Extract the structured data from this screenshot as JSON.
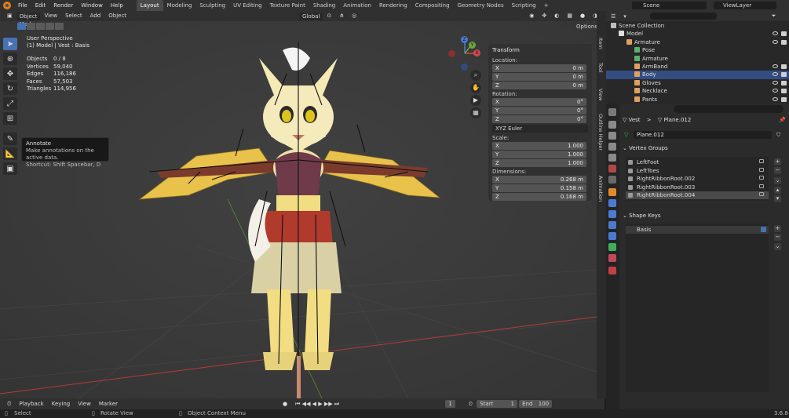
{
  "menu": [
    "File",
    "Edit",
    "Render",
    "Window",
    "Help"
  ],
  "workspaces": [
    {
      "label": "Layout",
      "active": true
    },
    {
      "label": "Modeling",
      "active": false
    },
    {
      "label": "Sculpting",
      "active": false
    },
    {
      "label": "UV Editing",
      "active": false
    },
    {
      "label": "Texture Paint",
      "active": false
    },
    {
      "label": "Shading",
      "active": false
    },
    {
      "label": "Animation",
      "active": false
    },
    {
      "label": "Rendering",
      "active": false
    },
    {
      "label": "Compositing",
      "active": false
    },
    {
      "label": "Geometry Nodes",
      "active": false
    },
    {
      "label": "Scripting",
      "active": false
    }
  ],
  "add_workspace": "+",
  "scene": "Scene",
  "view_layer": "ViewLayer",
  "viewport": {
    "mode": "Object Mode",
    "menus": [
      "View",
      "Select",
      "Add",
      "Object"
    ],
    "transform_orientation": "Global",
    "options": "Options",
    "perspective": "User Perspective",
    "context": "(1) Model | Vest : Basis",
    "stats": [
      {
        "k": "Objects",
        "v": "0 / 8"
      },
      {
        "k": "Vertices",
        "v": "59,040"
      },
      {
        "k": "Edges",
        "v": "116,186"
      },
      {
        "k": "Faces",
        "v": "57,503"
      },
      {
        "k": "Triangles",
        "v": "114,956"
      }
    ],
    "tooltip": {
      "title": "Annotate",
      "desc": "Make annotations on the active data.",
      "shortcut": "Shortcut: Shift Spacebar, D"
    },
    "gizmo": {
      "x": "X",
      "y": "Y",
      "z": "Z"
    }
  },
  "sidebar_tabs": [
    "Item",
    "Tool",
    "View",
    "Outline Helper",
    "Animation"
  ],
  "transform": {
    "title": "Transform",
    "location_label": "Location:",
    "location": [
      {
        "a": "X",
        "v": "0 m"
      },
      {
        "a": "Y",
        "v": "0 m"
      },
      {
        "a": "Z",
        "v": "0 m"
      }
    ],
    "rotation_label": "Rotation:",
    "rotation": [
      {
        "a": "X",
        "v": "0°"
      },
      {
        "a": "Y",
        "v": "0°"
      },
      {
        "a": "Z",
        "v": "0°"
      }
    ],
    "rotation_mode": "XYZ Euler",
    "scale_label": "Scale:",
    "scale": [
      {
        "a": "X",
        "v": "1.000"
      },
      {
        "a": "Y",
        "v": "1.000"
      },
      {
        "a": "Z",
        "v": "1.000"
      }
    ],
    "dimensions_label": "Dimensions:",
    "dimensions": [
      {
        "a": "X",
        "v": "0.268 m"
      },
      {
        "a": "Y",
        "v": "0.158 m"
      },
      {
        "a": "Z",
        "v": "0.168 m"
      }
    ]
  },
  "timeline": {
    "menus": [
      "Playback",
      "Keying",
      "View",
      "Marker"
    ],
    "current_frame": "1",
    "start_label": "Start",
    "start": "1",
    "end_label": "End",
    "end": "100"
  },
  "status": {
    "select": "Select",
    "rotate": "Rotate View",
    "context": "Object Context Menu",
    "version": "3.6.8"
  },
  "outliner": {
    "rows": [
      {
        "label": "Scene Collection",
        "indent": 0,
        "color": "#bdbdbd",
        "sel": false,
        "vis": false
      },
      {
        "label": "Model",
        "indent": 1,
        "color": "#e0e0e0",
        "sel": false,
        "vis": true
      },
      {
        "label": "Armature",
        "indent": 2,
        "color": "#e0a060",
        "sel": false,
        "vis": true
      },
      {
        "label": "Pose",
        "indent": 3,
        "color": "#59b36e",
        "sel": false,
        "vis": false
      },
      {
        "label": "Armature",
        "indent": 3,
        "color": "#59b36e",
        "sel": false,
        "vis": false
      },
      {
        "label": "ArmBand",
        "indent": 3,
        "color": "#e0a060",
        "sel": false,
        "vis": true
      },
      {
        "label": "Body",
        "indent": 3,
        "color": "#e0a060",
        "sel": true,
        "vis": true
      },
      {
        "label": "Gloves",
        "indent": 3,
        "color": "#e0a060",
        "sel": false,
        "vis": true
      },
      {
        "label": "Necklace",
        "indent": 3,
        "color": "#e0a060",
        "sel": false,
        "vis": true
      },
      {
        "label": "Pants",
        "indent": 3,
        "color": "#e0a060",
        "sel": false,
        "vis": true
      }
    ]
  },
  "properties": {
    "breadcrumb_object": "Vest",
    "breadcrumb_sep": ">",
    "breadcrumb_data": "Plane.012",
    "mesh_name": "Plane.012",
    "vertex_groups_title": "Vertex Groups",
    "vertex_groups": [
      {
        "label": "LeftFoot",
        "sel": false
      },
      {
        "label": "LeftToes",
        "sel": false
      },
      {
        "label": "RightRibbonRoot.002",
        "sel": false
      },
      {
        "label": "RightRibbonRoot.003",
        "sel": false
      },
      {
        "label": "RightRibbonRoot.004",
        "sel": true
      }
    ],
    "shape_keys_title": "Shape Keys",
    "shape_keys": [
      {
        "label": "Basis"
      }
    ]
  }
}
